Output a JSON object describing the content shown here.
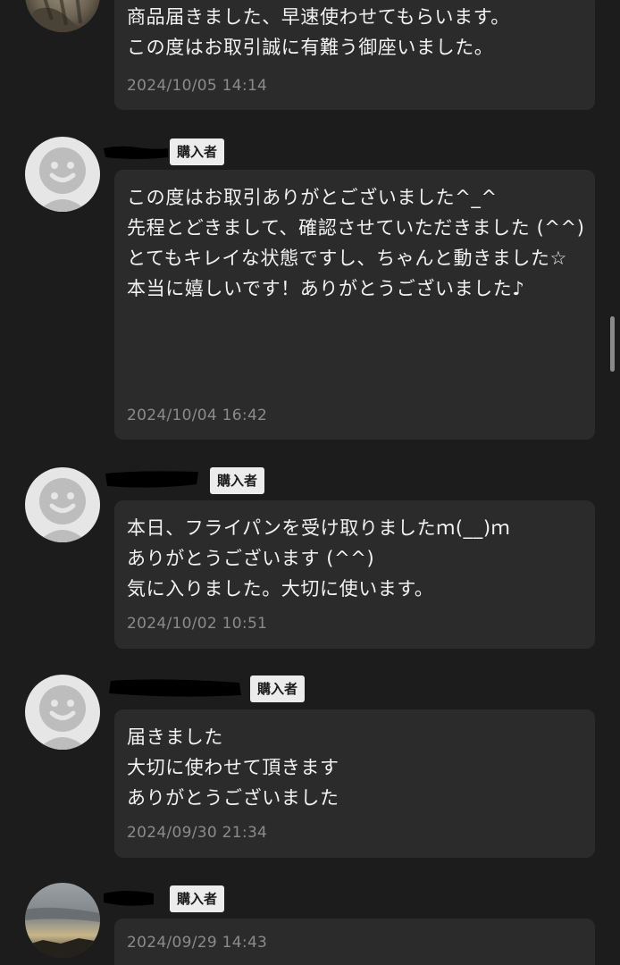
{
  "reviews": [
    {
      "role_badge": "",
      "message": "商品届きました、早速使わせてもらいます。\nこの度はお取引誠に有難う御座いました。",
      "timestamp": "2024/10/05 14:14",
      "avatar": "cat-photo"
    },
    {
      "role_badge": "購入者",
      "message": "この度はお取引ありがとございました^_^\n先程とどきまして、確認させていただきました (^^)\nとてもキレイな状態ですし、ちゃんと動きました☆\n本当に嬉しいです！ありがとうございました♪",
      "timestamp": "2024/10/04 16:42",
      "avatar": "default-user-icon"
    },
    {
      "role_badge": "購入者",
      "message": "本日、フライパンを受け取りましたｍ(__)ｍ\nありがとうございます (^^)\n気に入りました。大切に使います。",
      "timestamp": "2024/10/02 10:51",
      "avatar": "default-user-icon"
    },
    {
      "role_badge": "購入者",
      "message": "届きました\n大切に使わせて頂きます\nありがとうございました",
      "timestamp": "2024/09/30 21:34",
      "avatar": "default-user-icon"
    },
    {
      "role_badge": "購入者",
      "message": "",
      "timestamp": "2024/09/29 14:43",
      "avatar": "sunset-sky-photo"
    }
  ]
}
